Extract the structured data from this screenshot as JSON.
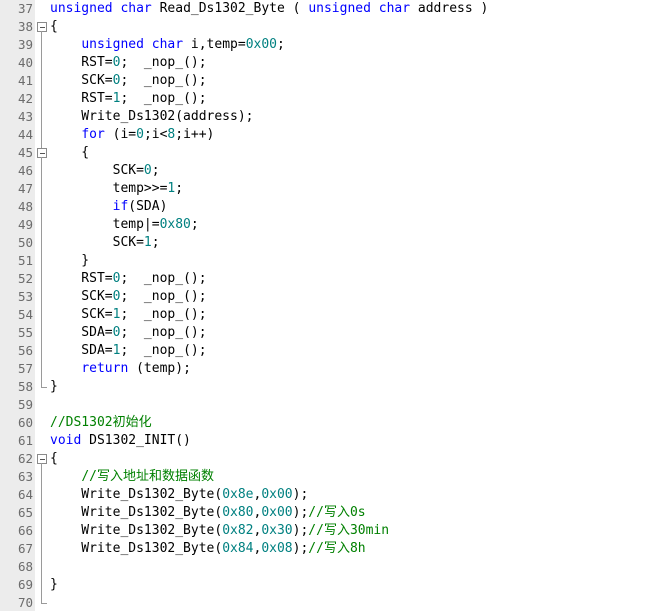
{
  "colors": {
    "keyword": "#0000ff",
    "number": "#008080",
    "comment": "#008000",
    "text": "#000000",
    "gutter_background": "#ececec",
    "line_number": "#6c6c6c"
  },
  "lines": [
    {
      "num": "37",
      "fold": "none",
      "tokens": [
        {
          "t": "unsigned",
          "c": "kw"
        },
        {
          "t": " ",
          "c": ""
        },
        {
          "t": "char",
          "c": "kw"
        },
        {
          "t": " Read_Ds1302_Byte ( ",
          "c": ""
        },
        {
          "t": "unsigned",
          "c": "kw"
        },
        {
          "t": " ",
          "c": ""
        },
        {
          "t": "char",
          "c": "kw"
        },
        {
          "t": " address )",
          "c": ""
        }
      ]
    },
    {
      "num": "38",
      "fold": "open",
      "tokens": [
        {
          "t": "{",
          "c": ""
        }
      ]
    },
    {
      "num": "39",
      "fold": "line",
      "tokens": [
        {
          "t": "    ",
          "c": ""
        },
        {
          "t": "unsigned",
          "c": "kw"
        },
        {
          "t": " ",
          "c": ""
        },
        {
          "t": "char",
          "c": "kw"
        },
        {
          "t": " i,temp=",
          "c": ""
        },
        {
          "t": "0x00",
          "c": "num"
        },
        {
          "t": ";",
          "c": ""
        }
      ]
    },
    {
      "num": "40",
      "fold": "line",
      "tokens": [
        {
          "t": "    RST=",
          "c": ""
        },
        {
          "t": "0",
          "c": "num"
        },
        {
          "t": ";  _nop_();",
          "c": ""
        }
      ]
    },
    {
      "num": "41",
      "fold": "line",
      "tokens": [
        {
          "t": "    SCK=",
          "c": ""
        },
        {
          "t": "0",
          "c": "num"
        },
        {
          "t": ";  _nop_();",
          "c": ""
        }
      ]
    },
    {
      "num": "42",
      "fold": "line",
      "tokens": [
        {
          "t": "    RST=",
          "c": ""
        },
        {
          "t": "1",
          "c": "num"
        },
        {
          "t": ";  _nop_();",
          "c": ""
        }
      ]
    },
    {
      "num": "43",
      "fold": "line",
      "tokens": [
        {
          "t": "    Write_Ds1302(address);",
          "c": ""
        }
      ]
    },
    {
      "num": "44",
      "fold": "line",
      "tokens": [
        {
          "t": "    ",
          "c": ""
        },
        {
          "t": "for",
          "c": "kw"
        },
        {
          "t": " (i=",
          "c": ""
        },
        {
          "t": "0",
          "c": "num"
        },
        {
          "t": ";i<",
          "c": ""
        },
        {
          "t": "8",
          "c": "num"
        },
        {
          "t": ";i++)",
          "c": ""
        }
      ]
    },
    {
      "num": "45",
      "fold": "open-nested",
      "tokens": [
        {
          "t": "    {",
          "c": ""
        }
      ]
    },
    {
      "num": "46",
      "fold": "line",
      "tokens": [
        {
          "t": "        SCK=",
          "c": ""
        },
        {
          "t": "0",
          "c": "num"
        },
        {
          "t": ";",
          "c": ""
        }
      ]
    },
    {
      "num": "47",
      "fold": "line",
      "tokens": [
        {
          "t": "        temp>>=",
          "c": ""
        },
        {
          "t": "1",
          "c": "num"
        },
        {
          "t": ";",
          "c": ""
        }
      ]
    },
    {
      "num": "48",
      "fold": "line",
      "tokens": [
        {
          "t": "        ",
          "c": ""
        },
        {
          "t": "if",
          "c": "kw"
        },
        {
          "t": "(SDA)",
          "c": ""
        }
      ]
    },
    {
      "num": "49",
      "fold": "line",
      "tokens": [
        {
          "t": "        temp|=",
          "c": ""
        },
        {
          "t": "0x80",
          "c": "num"
        },
        {
          "t": ";",
          "c": ""
        }
      ]
    },
    {
      "num": "50",
      "fold": "line",
      "tokens": [
        {
          "t": "        SCK=",
          "c": ""
        },
        {
          "t": "1",
          "c": "num"
        },
        {
          "t": ";",
          "c": ""
        }
      ]
    },
    {
      "num": "51",
      "fold": "end-nested",
      "tokens": [
        {
          "t": "    }",
          "c": ""
        }
      ]
    },
    {
      "num": "52",
      "fold": "line",
      "tokens": [
        {
          "t": "    RST=",
          "c": ""
        },
        {
          "t": "0",
          "c": "num"
        },
        {
          "t": ";  _nop_();",
          "c": ""
        }
      ]
    },
    {
      "num": "53",
      "fold": "line",
      "tokens": [
        {
          "t": "    SCK=",
          "c": ""
        },
        {
          "t": "0",
          "c": "num"
        },
        {
          "t": ";  _nop_();",
          "c": ""
        }
      ]
    },
    {
      "num": "54",
      "fold": "line",
      "tokens": [
        {
          "t": "    SCK=",
          "c": ""
        },
        {
          "t": "1",
          "c": "num"
        },
        {
          "t": ";  _nop_();",
          "c": ""
        }
      ]
    },
    {
      "num": "55",
      "fold": "line",
      "tokens": [
        {
          "t": "    SDA=",
          "c": ""
        },
        {
          "t": "0",
          "c": "num"
        },
        {
          "t": ";  _nop_();",
          "c": ""
        }
      ]
    },
    {
      "num": "56",
      "fold": "line",
      "tokens": [
        {
          "t": "    SDA=",
          "c": ""
        },
        {
          "t": "1",
          "c": "num"
        },
        {
          "t": ";  _nop_();",
          "c": ""
        }
      ]
    },
    {
      "num": "57",
      "fold": "line",
      "tokens": [
        {
          "t": "    ",
          "c": ""
        },
        {
          "t": "return",
          "c": "kw"
        },
        {
          "t": " (temp);",
          "c": ""
        }
      ]
    },
    {
      "num": "58",
      "fold": "end",
      "tokens": [
        {
          "t": "}",
          "c": ""
        }
      ]
    },
    {
      "num": "59",
      "fold": "none",
      "tokens": []
    },
    {
      "num": "60",
      "fold": "none",
      "tokens": [
        {
          "t": "//DS1302初始化",
          "c": "cmt"
        }
      ]
    },
    {
      "num": "61",
      "fold": "none",
      "tokens": [
        {
          "t": "void",
          "c": "kw"
        },
        {
          "t": " DS1302_INIT()",
          "c": ""
        }
      ]
    },
    {
      "num": "62",
      "fold": "open",
      "tokens": [
        {
          "t": "{",
          "c": ""
        }
      ]
    },
    {
      "num": "63",
      "fold": "line",
      "tokens": [
        {
          "t": "    ",
          "c": ""
        },
        {
          "t": "//写入地址和数据函数",
          "c": "cmt"
        }
      ]
    },
    {
      "num": "64",
      "fold": "line",
      "tokens": [
        {
          "t": "    Write_Ds1302_Byte(",
          "c": ""
        },
        {
          "t": "0x8e",
          "c": "num"
        },
        {
          "t": ",",
          "c": ""
        },
        {
          "t": "0x00",
          "c": "num"
        },
        {
          "t": ");",
          "c": ""
        }
      ]
    },
    {
      "num": "65",
      "fold": "line",
      "tokens": [
        {
          "t": "    Write_Ds1302_Byte(",
          "c": ""
        },
        {
          "t": "0x80",
          "c": "num"
        },
        {
          "t": ",",
          "c": ""
        },
        {
          "t": "0x00",
          "c": "num"
        },
        {
          "t": ");",
          "c": ""
        },
        {
          "t": "//写入0s",
          "c": "cmt"
        }
      ]
    },
    {
      "num": "66",
      "fold": "line",
      "tokens": [
        {
          "t": "    Write_Ds1302_Byte(",
          "c": ""
        },
        {
          "t": "0x82",
          "c": "num"
        },
        {
          "t": ",",
          "c": ""
        },
        {
          "t": "0x30",
          "c": "num"
        },
        {
          "t": ");",
          "c": ""
        },
        {
          "t": "//写入30min",
          "c": "cmt"
        }
      ]
    },
    {
      "num": "67",
      "fold": "line",
      "tokens": [
        {
          "t": "    Write_Ds1302_Byte(",
          "c": ""
        },
        {
          "t": "0x84",
          "c": "num"
        },
        {
          "t": ",",
          "c": ""
        },
        {
          "t": "0x08",
          "c": "num"
        },
        {
          "t": ");",
          "c": ""
        },
        {
          "t": "//写入8h",
          "c": "cmt"
        }
      ]
    },
    {
      "num": "68",
      "fold": "line",
      "tokens": []
    },
    {
      "num": "69",
      "fold": "line",
      "tokens": [
        {
          "t": "}",
          "c": ""
        }
      ]
    },
    {
      "num": "70",
      "fold": "end",
      "tokens": []
    }
  ]
}
